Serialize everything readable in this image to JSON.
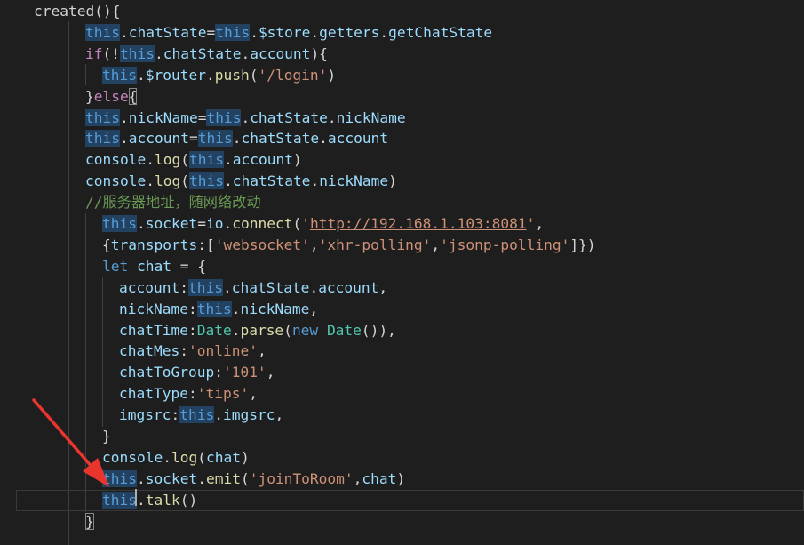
{
  "editor": {
    "lines": [
      [
        [
          "created(){",
          "t-punc"
        ]
      ],
      [
        [
          "this",
          "t-this"
        ],
        [
          ".",
          "t-punc"
        ],
        [
          "chatState",
          "t-var"
        ],
        [
          "=",
          "t-punc"
        ],
        [
          "this",
          "t-this"
        ],
        [
          ".",
          "t-punc"
        ],
        [
          "$store",
          "t-var"
        ],
        [
          ".",
          "t-punc"
        ],
        [
          "getters",
          "t-var"
        ],
        [
          ".",
          "t-punc"
        ],
        [
          "getChatState",
          "t-var"
        ]
      ],
      [
        [
          "if",
          "t-ctl"
        ],
        [
          "(!",
          "t-punc"
        ],
        [
          "this",
          "t-this"
        ],
        [
          ".",
          "t-punc"
        ],
        [
          "chatState",
          "t-var"
        ],
        [
          ".",
          "t-punc"
        ],
        [
          "account",
          "t-var"
        ],
        [
          "){",
          "t-punc"
        ]
      ],
      [
        [
          "this",
          "t-this"
        ],
        [
          ".",
          "t-punc"
        ],
        [
          "$router",
          "t-var"
        ],
        [
          ".",
          "t-punc"
        ],
        [
          "push",
          "t-fn"
        ],
        [
          "(",
          "t-punc"
        ],
        [
          "'/login'",
          "t-str"
        ],
        [
          ")",
          "t-punc"
        ]
      ],
      [
        [
          "}",
          "t-punc"
        ],
        [
          "else",
          "t-ctl"
        ],
        [
          "{",
          "t-brace"
        ]
      ],
      [
        [
          "this",
          "t-this"
        ],
        [
          ".",
          "t-punc"
        ],
        [
          "nickName",
          "t-var"
        ],
        [
          "=",
          "t-punc"
        ],
        [
          "this",
          "t-this"
        ],
        [
          ".",
          "t-punc"
        ],
        [
          "chatState",
          "t-var"
        ],
        [
          ".",
          "t-punc"
        ],
        [
          "nickName",
          "t-var"
        ]
      ],
      [
        [
          "this",
          "t-this"
        ],
        [
          ".",
          "t-punc"
        ],
        [
          "account",
          "t-var"
        ],
        [
          "=",
          "t-punc"
        ],
        [
          "this",
          "t-this"
        ],
        [
          ".",
          "t-punc"
        ],
        [
          "chatState",
          "t-var"
        ],
        [
          ".",
          "t-punc"
        ],
        [
          "account",
          "t-var"
        ]
      ],
      [
        [
          "console",
          "t-var"
        ],
        [
          ".",
          "t-punc"
        ],
        [
          "log",
          "t-fn"
        ],
        [
          "(",
          "t-punc"
        ],
        [
          "this",
          "t-this"
        ],
        [
          ".",
          "t-punc"
        ],
        [
          "account",
          "t-var"
        ],
        [
          ")",
          "t-punc"
        ]
      ],
      [
        [
          "console",
          "t-var"
        ],
        [
          ".",
          "t-punc"
        ],
        [
          "log",
          "t-fn"
        ],
        [
          "(",
          "t-punc"
        ],
        [
          "this",
          "t-this"
        ],
        [
          ".",
          "t-punc"
        ],
        [
          "chatState",
          "t-var"
        ],
        [
          ".",
          "t-punc"
        ],
        [
          "nickName",
          "t-var"
        ],
        [
          ")",
          "t-punc"
        ]
      ],
      [
        [
          "//服务器地址，随网络改动",
          "t-cmt"
        ]
      ],
      [
        [
          "this",
          "t-this"
        ],
        [
          ".",
          "t-punc"
        ],
        [
          "socket",
          "t-var"
        ],
        [
          "=",
          "t-punc"
        ],
        [
          "io",
          "t-var"
        ],
        [
          ".",
          "t-punc"
        ],
        [
          "connect",
          "t-fn"
        ],
        [
          "(",
          "t-punc"
        ],
        [
          "'",
          "t-str"
        ],
        [
          "http://192.168.1.103:8081",
          "t-url"
        ],
        [
          "'",
          "t-str"
        ],
        [
          ",",
          "t-punc"
        ]
      ],
      [
        [
          "{",
          "t-punc"
        ],
        [
          "transports",
          "t-var"
        ],
        [
          ":[",
          "t-punc"
        ],
        [
          "'websocket'",
          "t-str"
        ],
        [
          ",",
          "t-punc"
        ],
        [
          "'xhr-polling'",
          "t-str"
        ],
        [
          ",",
          "t-punc"
        ],
        [
          "'jsonp-polling'",
          "t-str"
        ],
        [
          "]})",
          "t-punc"
        ]
      ],
      [
        [
          "let",
          "t-kw"
        ],
        [
          " ",
          "t-punc"
        ],
        [
          "chat",
          "t-var"
        ],
        [
          " = {",
          "t-punc"
        ]
      ],
      [
        [
          "account",
          "t-var"
        ],
        [
          ":",
          "t-punc"
        ],
        [
          "this",
          "t-this"
        ],
        [
          ".",
          "t-punc"
        ],
        [
          "chatState",
          "t-var"
        ],
        [
          ".",
          "t-punc"
        ],
        [
          "account",
          "t-var"
        ],
        [
          ",",
          "t-punc"
        ]
      ],
      [
        [
          "nickName",
          "t-var"
        ],
        [
          ":",
          "t-punc"
        ],
        [
          "this",
          "t-this"
        ],
        [
          ".",
          "t-punc"
        ],
        [
          "nickName",
          "t-var"
        ],
        [
          ",",
          "t-punc"
        ]
      ],
      [
        [
          "chatTime",
          "t-var"
        ],
        [
          ":",
          "t-punc"
        ],
        [
          "Date",
          "t-cls"
        ],
        [
          ".",
          "t-punc"
        ],
        [
          "parse",
          "t-fn"
        ],
        [
          "(",
          "t-punc"
        ],
        [
          "new",
          "t-kw"
        ],
        [
          " ",
          "t-punc"
        ],
        [
          "Date",
          "t-cls"
        ],
        [
          "()),",
          "t-punc"
        ]
      ],
      [
        [
          "chatMes",
          "t-var"
        ],
        [
          ":",
          "t-punc"
        ],
        [
          "'online'",
          "t-str"
        ],
        [
          ",",
          "t-punc"
        ]
      ],
      [
        [
          "chatToGroup",
          "t-var"
        ],
        [
          ":",
          "t-punc"
        ],
        [
          "'101'",
          "t-str"
        ],
        [
          ",",
          "t-punc"
        ]
      ],
      [
        [
          "chatType",
          "t-var"
        ],
        [
          ":",
          "t-punc"
        ],
        [
          "'tips'",
          "t-str"
        ],
        [
          ",",
          "t-punc"
        ]
      ],
      [
        [
          "imgsrc",
          "t-var"
        ],
        [
          ":",
          "t-punc"
        ],
        [
          "this",
          "t-this"
        ],
        [
          ".",
          "t-punc"
        ],
        [
          "imgsrc",
          "t-var"
        ],
        [
          ",",
          "t-punc"
        ]
      ],
      [
        [
          "}",
          "t-punc"
        ]
      ],
      [
        [
          "console",
          "t-var"
        ],
        [
          ".",
          "t-punc"
        ],
        [
          "log",
          "t-fn"
        ],
        [
          "(",
          "t-punc"
        ],
        [
          "chat",
          "t-var"
        ],
        [
          ")",
          "t-punc"
        ]
      ],
      [
        [
          "this",
          "t-this"
        ],
        [
          ".",
          "t-punc"
        ],
        [
          "socket",
          "t-var"
        ],
        [
          ".",
          "t-punc"
        ],
        [
          "emit",
          "t-fn"
        ],
        [
          "(",
          "t-punc"
        ],
        [
          "'joinToRoom'",
          "t-str"
        ],
        [
          ",",
          "t-punc"
        ],
        [
          "chat",
          "t-var"
        ],
        [
          ")",
          "t-punc"
        ]
      ],
      [
        [
          "this",
          "t-this"
        ],
        [
          ".",
          "t-punc"
        ],
        [
          "talk",
          "t-fn"
        ],
        [
          "()",
          "t-punc"
        ]
      ],
      [
        [
          "}",
          "t-brace"
        ]
      ]
    ],
    "colors": {
      "background": "#1e1e1e",
      "keyword": "#569cd6",
      "variable": "#9cdcfe",
      "function": "#dcdcaa",
      "string": "#ce9178",
      "comment": "#6a9955",
      "control": "#c586c0",
      "class": "#4ec9b0",
      "annotation_arrow": "#e8352e"
    },
    "annotation_icon": "red-arrow-icon"
  }
}
